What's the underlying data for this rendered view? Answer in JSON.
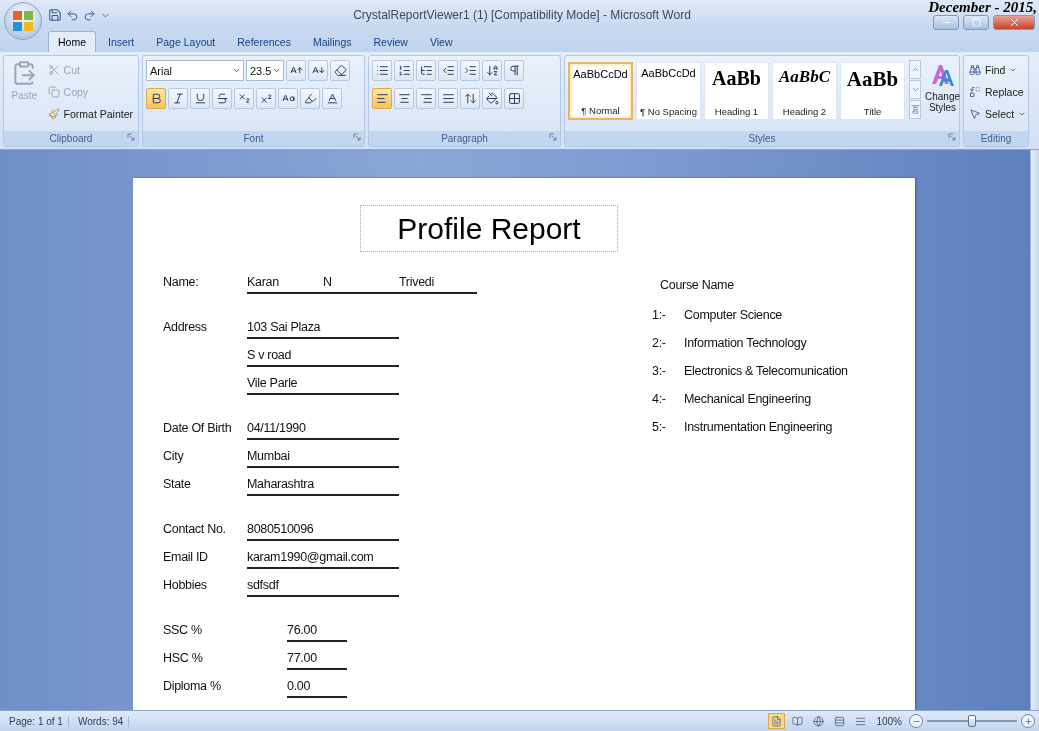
{
  "window": {
    "title": "CrystalReportViewer1 (1) [Compatibility Mode] - Microsoft Word"
  },
  "page_header": "December - 2015,",
  "tabs": [
    {
      "label": "Home",
      "selected": true
    },
    {
      "label": "Insert",
      "selected": false
    },
    {
      "label": "Page Layout",
      "selected": false
    },
    {
      "label": "References",
      "selected": false
    },
    {
      "label": "Mailings",
      "selected": false
    },
    {
      "label": "Review",
      "selected": false
    },
    {
      "label": "View",
      "selected": false
    }
  ],
  "ribbon": {
    "clipboard": {
      "label": "Clipboard",
      "paste": {
        "label": "Paste",
        "disabled": true
      },
      "actions": [
        {
          "kind": "cut",
          "label": "Cut",
          "disabled": true
        },
        {
          "kind": "copy",
          "label": "Copy",
          "disabled": true
        },
        {
          "kind": "format-painter",
          "label": "Format Painter",
          "disabled": false
        }
      ]
    },
    "font": {
      "label": "Font",
      "name": "Arial",
      "size": "23.5",
      "toggles": [
        {
          "kind": "bold",
          "on": true
        },
        {
          "kind": "italic",
          "on": false
        },
        {
          "kind": "underline",
          "on": false
        },
        {
          "kind": "strikethrough",
          "on": false
        },
        {
          "kind": "subscript",
          "on": false
        },
        {
          "kind": "superscript",
          "on": false
        },
        {
          "kind": "change-case",
          "on": false
        },
        {
          "kind": "highlight",
          "on": false
        },
        {
          "kind": "font-color",
          "on": false
        }
      ]
    },
    "paragraph": {
      "label": "Paragraph",
      "toggles": [
        {
          "kind": "bullets",
          "on": false
        },
        {
          "kind": "numbering",
          "on": false
        },
        {
          "kind": "multilevel",
          "on": false
        },
        {
          "kind": "decrease-indent",
          "on": false
        },
        {
          "kind": "increase-indent",
          "on": false
        },
        {
          "kind": "sort",
          "on": false
        },
        {
          "kind": "show-marks",
          "on": false
        },
        {
          "kind": "align-left",
          "on": true
        },
        {
          "kind": "align-center",
          "on": false
        },
        {
          "kind": "align-right",
          "on": false
        },
        {
          "kind": "justify",
          "on": false
        },
        {
          "kind": "line-spacing",
          "on": false
        },
        {
          "kind": "shading",
          "on": false
        },
        {
          "kind": "borders",
          "on": false
        }
      ]
    },
    "styles": {
      "label": "Styles",
      "items": [
        {
          "kind": "normal",
          "preview": "AaBbCcDd",
          "name": "¶ Normal",
          "selected": true
        },
        {
          "kind": "normal",
          "preview": "AaBbCcDd",
          "name": "¶ No Spacing",
          "selected": false
        },
        {
          "kind": "heading1",
          "preview": "AaBb",
          "name": "Heading 1",
          "selected": false
        },
        {
          "kind": "heading2",
          "preview": "AaBbC",
          "name": "Heading 2",
          "selected": false
        },
        {
          "kind": "title",
          "preview": "AaBb",
          "name": "Title",
          "selected": false
        }
      ],
      "change_styles": "Change Styles"
    },
    "editing": {
      "label": "Editing",
      "items": [
        {
          "kind": "find",
          "label": "Find"
        },
        {
          "kind": "replace",
          "label": "Replace"
        },
        {
          "kind": "select",
          "label": "Select"
        }
      ]
    }
  },
  "document": {
    "title": "Profile Report",
    "sections": [
      {
        "kind": "details",
        "rows": [
          {
            "label": "Name:",
            "lines": [
              [
                "Karan",
                "N",
                "Trivedi"
              ]
            ]
          }
        ]
      },
      {
        "kind": "details",
        "rows": [
          {
            "label": "Address",
            "lines": [
              [
                "103 Sai Plaza"
              ],
              [
                "S v road"
              ],
              [
                "Vile Parle"
              ]
            ]
          }
        ]
      },
      {
        "kind": "details",
        "rows": [
          {
            "label": "Date Of Birth",
            "lines": [
              [
                "04/11/1990"
              ]
            ]
          },
          {
            "label": "City",
            "lines": [
              [
                "Mumbai"
              ]
            ]
          },
          {
            "label": "State",
            "lines": [
              [
                "Maharashtra"
              ]
            ]
          }
        ]
      },
      {
        "kind": "details",
        "rows": [
          {
            "label": "Contact No.",
            "lines": [
              [
                "8080510096"
              ]
            ]
          },
          {
            "label": "Email ID",
            "lines": [
              [
                "karam1990@gmail.com"
              ]
            ]
          },
          {
            "label": "Hobbies",
            "lines": [
              [
                "sdfsdf"
              ]
            ]
          }
        ]
      },
      {
        "kind": "scores",
        "rows": [
          {
            "label": "SSC %",
            "lines": [
              [
                "76.00"
              ]
            ]
          },
          {
            "label": "HSC %",
            "lines": [
              [
                "77.00"
              ]
            ]
          },
          {
            "label": "Diploma %",
            "lines": [
              [
                "0.00"
              ]
            ]
          }
        ]
      }
    ],
    "courses": {
      "heading": "Course Name",
      "items": [
        {
          "number": "1:-",
          "name": "Computer Science"
        },
        {
          "number": "2:-",
          "name": "Information Technology"
        },
        {
          "number": "3:-",
          "name": "Electronics & Telecomunication"
        },
        {
          "number": "4:-",
          "name": "Mechanical Engineering"
        },
        {
          "number": "5:-",
          "name": "Instrumentation Engineering"
        }
      ]
    }
  },
  "status_bar": {
    "page": "Page: 1 of 1",
    "words": "Words: 94",
    "views": [
      {
        "kind": "print-layout",
        "selected": true
      },
      {
        "kind": "full-screen",
        "selected": false
      },
      {
        "kind": "web",
        "selected": false
      },
      {
        "kind": "outline",
        "selected": false
      },
      {
        "kind": "draft",
        "selected": false
      }
    ],
    "zoom": "100%",
    "zoom_slider": {
      "level": 0.5
    }
  }
}
